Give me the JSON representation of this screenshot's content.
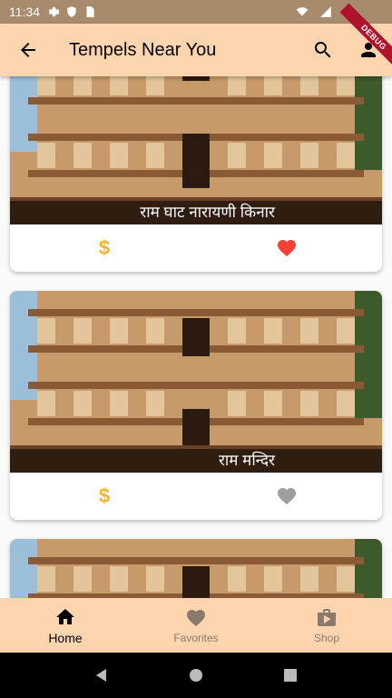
{
  "status_bar": {
    "time": "11:34",
    "debug_label": "DEBUG"
  },
  "app_bar": {
    "title": "Tempels Near You",
    "icons": [
      "back-arrow-icon",
      "search-icon",
      "person-icon"
    ]
  },
  "cards": [
    {
      "caption": "राम घाट नारायणी किनार",
      "price_icon": "$",
      "favorite": true
    },
    {
      "caption": "राम मन्दिर",
      "price_icon": "$",
      "favorite": false
    },
    {
      "caption": "",
      "price_icon": "$",
      "favorite": false
    }
  ],
  "bottom_nav": {
    "items": [
      {
        "label": "Home",
        "icon": "home-icon",
        "active": true
      },
      {
        "label": "Favorites",
        "icon": "heart-icon",
        "active": false
      },
      {
        "label": "Shop",
        "icon": "shop-icon",
        "active": false
      }
    ]
  },
  "colors": {
    "app_bar": "#ffd5b0",
    "status_bar": "#a88a6d",
    "favorite_active": "#f44336",
    "favorite_inactive": "#9e9e9e",
    "dollar": "#f9b22b",
    "nav_active": "#000000",
    "nav_inactive": "#8a7a6c"
  }
}
